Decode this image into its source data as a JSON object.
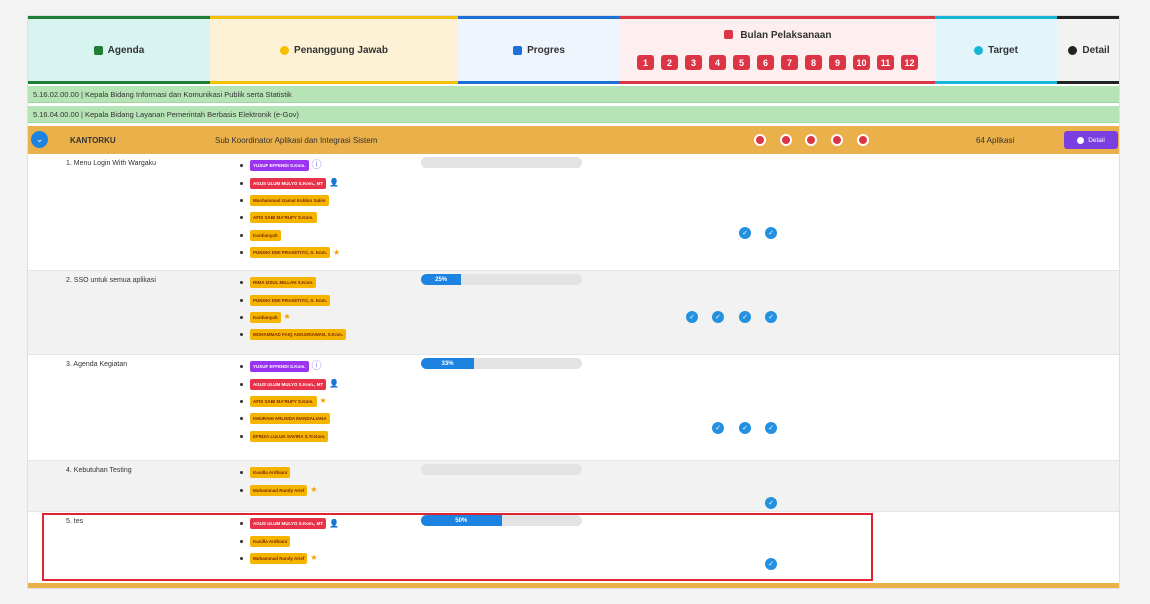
{
  "header": {
    "agenda": "Agenda",
    "penanggung_jawab": "Penanggung Jawab",
    "progres": "Progres",
    "bulan": "Bulan Pelaksanaan",
    "months": [
      "1",
      "2",
      "3",
      "4",
      "5",
      "6",
      "7",
      "8",
      "9",
      "10",
      "11",
      "12"
    ],
    "target": "Target",
    "detail": "Detail"
  },
  "categories": [
    "5.16.02.00.00 | Kepala Bidang Informasi dan Komunikasi Publik serta Statistik",
    "5.16.04.00.00 | Kepala Bidang Layanan Pemerintah Berbasis Elektronik (e-Gov)"
  ],
  "kantor": {
    "name": "KANTORKU",
    "sub": "Sub Koordinator Aplikasi dan Integrasi Sistem",
    "target": "64 Aplikasi",
    "detail_label": "Detail"
  },
  "rows": [
    {
      "name": "1. Menu Login With Wargaku",
      "progress_percent": 0,
      "progress_label": "",
      "people": [
        {
          "name": "YUSUF EFFENDI S.Kom.",
          "color": "purple",
          "mark": "circle"
        },
        {
          "name": "AGUS ULUM MULYO S.Kom., MT",
          "color": "red",
          "mark": "user"
        },
        {
          "name": "Mochammad Gamal Kobbin Salim",
          "color": "yellow",
          "mark": ""
        },
        {
          "name": "AFIS SABI MA'RUFY S.Kom.",
          "color": "yellow",
          "mark": ""
        },
        {
          "name": "Kardianyah",
          "color": "yellow",
          "mark": ""
        },
        {
          "name": "PUNGKI DWI PRASETIYO, S. Kom.",
          "color": "yellow",
          "mark": "star"
        }
      ]
    },
    {
      "name": "2. SSO untuk semua aplikasi",
      "progress_percent": 25,
      "progress_label": "25%",
      "people": [
        {
          "name": "RIMA IZZUL MILLAH S.Kom.",
          "color": "yellow",
          "mark": ""
        },
        {
          "name": "PUNGKI DWI PRASETIYO, S. Kom.",
          "color": "yellow",
          "mark": ""
        },
        {
          "name": "Kardianyah",
          "color": "yellow",
          "mark": "star"
        },
        {
          "name": "MOHAMMAD FAIQ ANGGRIAWAN, S.Kom.",
          "color": "yellow",
          "mark": ""
        }
      ]
    },
    {
      "name": "3. Agenda Kegiatan",
      "progress_percent": 33,
      "progress_label": "33%",
      "people": [
        {
          "name": "YUSUF EFFENDI S.Kom.",
          "color": "purple",
          "mark": "circle"
        },
        {
          "name": "AGUS ULUM MULYO S.Kom., MT",
          "color": "red",
          "mark": "user"
        },
        {
          "name": "AFIS SABI MA'RUFY S.Kom.",
          "color": "yellow",
          "mark": "star"
        },
        {
          "name": "KHURAHI ARLINDA MANDALIANA",
          "color": "yellow",
          "mark": ""
        },
        {
          "name": "EFRIZA LULUK SAVIRA S.Tr.Kom.",
          "color": "yellow",
          "mark": ""
        }
      ]
    },
    {
      "name": "4. Kebutuhan Testing",
      "progress_percent": 0,
      "progress_label": "",
      "people": [
        {
          "name": "Kusilla Ardhiani",
          "color": "yellow",
          "mark": ""
        },
        {
          "name": "Muhammad Randy Arief",
          "color": "yellow",
          "mark": "star"
        }
      ]
    },
    {
      "name": "5. tes",
      "progress_percent": 50,
      "progress_label": "50%",
      "people": [
        {
          "name": "AGUS ULUM MULYO S.Kom., MT",
          "color": "red",
          "mark": "user"
        },
        {
          "name": "Kusilla Ardhiani",
          "color": "yellow",
          "mark": ""
        },
        {
          "name": "Muhammad Randy Arief",
          "color": "yellow",
          "mark": "star"
        }
      ]
    }
  ]
}
